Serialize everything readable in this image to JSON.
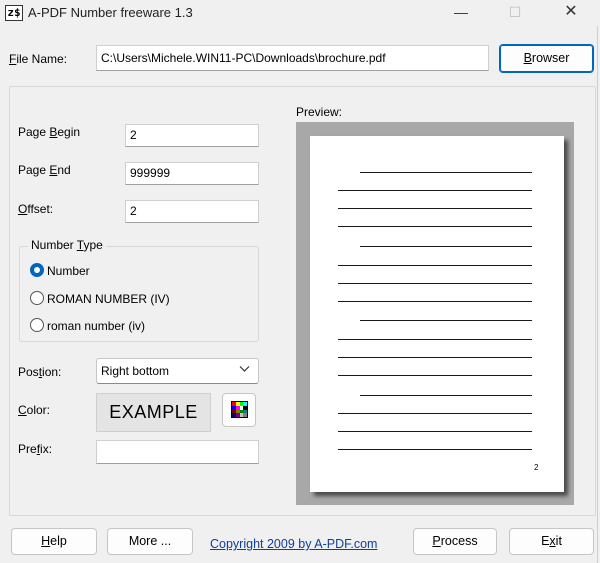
{
  "titlebar": {
    "icon_text": "z$",
    "title": "A-PDF Number freeware 1.3",
    "minimize": "—",
    "maximize": "☐",
    "close": "✕"
  },
  "file": {
    "label": "File Name:",
    "value": "C:\\Users\\Michele.WIN11-PC\\Downloads\\brochure.pdf",
    "browse_label": "Browser"
  },
  "fields": {
    "page_begin_label": "Page Begin",
    "page_begin_value": "2",
    "page_end_label": "Page End",
    "page_end_value": "999999",
    "offset_label": "Offset:",
    "offset_value": "2"
  },
  "number_type": {
    "title": "Number Type",
    "options": [
      {
        "label": "Number",
        "checked": true
      },
      {
        "label": "ROMAN NUMBER (IV)",
        "checked": false
      },
      {
        "label": "roman number (iv)",
        "checked": false
      }
    ]
  },
  "position": {
    "label": "Postion:",
    "value": "Right bottom"
  },
  "color": {
    "label": "Color:",
    "example": "EXAMPLE",
    "palette": [
      "#ff0000",
      "#ffff00",
      "#00ff00",
      "#00ffff",
      "#0000ff",
      "#ff00ff",
      "#ffffff",
      "#000000",
      "#800000",
      "#808000",
      "#008000",
      "#008080",
      "#000080",
      "#800080",
      "#c0c0c0",
      "#808080"
    ]
  },
  "prefix": {
    "label": "Prefix:",
    "value": ""
  },
  "preview": {
    "label": "Preview:",
    "page_number": "2"
  },
  "footer": {
    "help_label": "Help",
    "more_label": "More ...",
    "copyright": "Copyright 2009 by A-PDF.com",
    "process_label": "Process",
    "exit_label": "Exit"
  }
}
